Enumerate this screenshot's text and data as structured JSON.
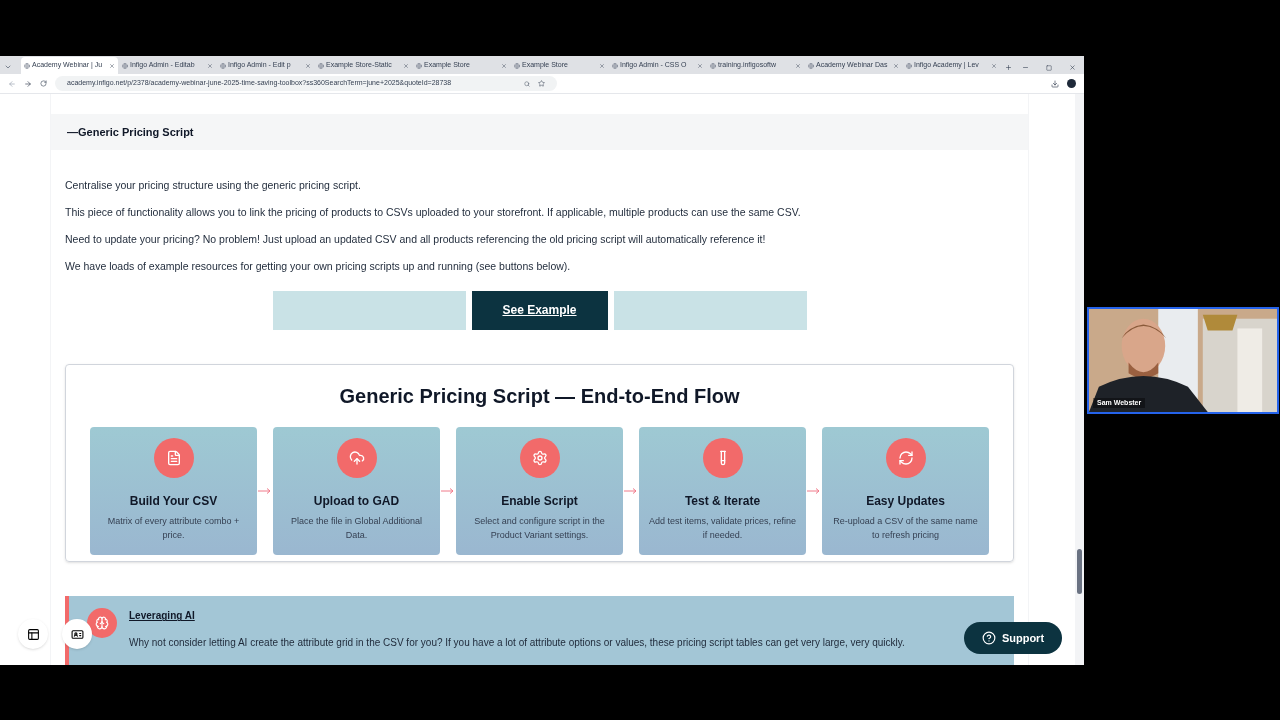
{
  "browser": {
    "tabs": [
      {
        "title": "Academy Webinar | Ju",
        "selected": true
      },
      {
        "title": "Infigo Admin - Editab",
        "selected": false
      },
      {
        "title": "Infigo Admin - Edit p",
        "selected": false
      },
      {
        "title": "Example Store-Static",
        "selected": false
      },
      {
        "title": "Example Store",
        "selected": false
      },
      {
        "title": "Example Store",
        "selected": false
      },
      {
        "title": "Infigo Admin - CSS O",
        "selected": false
      },
      {
        "title": "training.infigosoftw",
        "selected": false
      },
      {
        "title": "Academy Webinar Das",
        "selected": false
      },
      {
        "title": "Infigo Academy | Lev",
        "selected": false
      }
    ],
    "address": "academy.infigo.net/p/2378/academy-webinar-june-2025-time-saving-toolbox?ss360SearchTerm=june+2025&quoteId=28738"
  },
  "section": {
    "title": "—Generic Pricing Script",
    "paragraphs": [
      "Centralise your pricing structure using the generic pricing script.",
      "This piece of functionality allows you to link the pricing of products to CSVs uploaded to your storefront. If applicable, multiple products can use the same CSV.",
      "Need to update your pricing? No problem! Just upload an updated CSV and all products referencing the old pricing script will automatically reference it!",
      "We have loads of example resources for getting your own pricing scripts up and running (see buttons below)."
    ],
    "buttons": [
      {
        "kind": "faded"
      },
      {
        "kind": "primary",
        "label": "See Example"
      },
      {
        "kind": "faded"
      }
    ]
  },
  "flow": {
    "title": "Generic Pricing Script — End-to-End Flow",
    "steps": [
      {
        "title": "Build Your CSV",
        "text": "Matrix of every attribute combo + price."
      },
      {
        "title": "Upload to GAD",
        "text": "Place the file in Global Additional Data."
      },
      {
        "title": "Enable Script",
        "text": "Select and configure script in the Product Variant settings."
      },
      {
        "title": "Test & Iterate",
        "text": "Add test items, validate prices, refine if needed."
      },
      {
        "title": "Easy Updates",
        "text": "Re-upload a CSV of the same name to refresh pricing"
      }
    ]
  },
  "callout": {
    "title": "Leveraging AI",
    "text": "Why not consider letting AI create the attribute grid in the CSV for you? If you have a lot of attribute options or values, these pricing script tables can get very large, very quickly."
  },
  "support": {
    "label": "Support"
  },
  "video": {
    "name": "Sam Webster"
  }
}
